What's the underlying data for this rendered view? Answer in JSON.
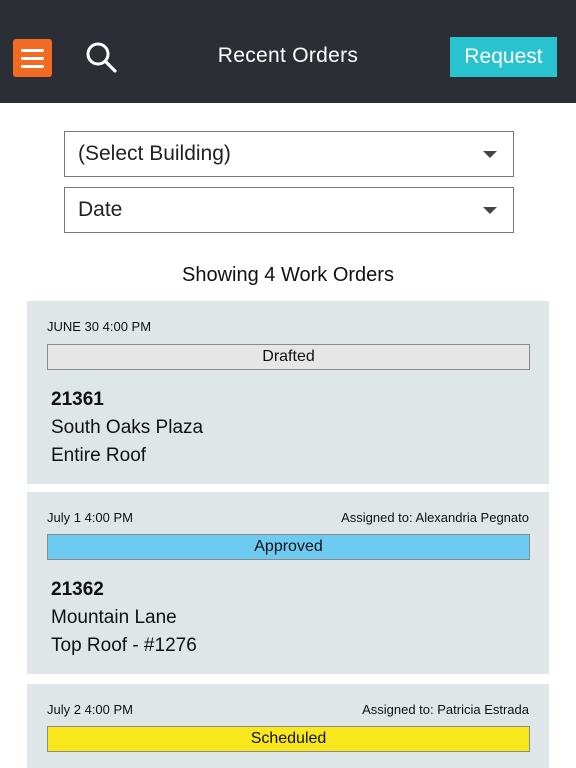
{
  "header": {
    "title": "Recent Orders",
    "request_label": "Request",
    "menu_icon": "hamburger-menu-icon",
    "search_icon": "search-icon",
    "menu_color": "#f26b22",
    "request_color": "#29c3cf"
  },
  "filters": {
    "building": "(Select Building)",
    "date": "Date"
  },
  "summary": "Showing 4 Work Orders",
  "orders": [
    {
      "date": "JUNE 30 4:00 PM",
      "assigned": "",
      "status": "Drafted",
      "status_color": "#e6e6e6",
      "number": "21361",
      "location": "South Oaks Plaza",
      "area": "Entire Roof"
    },
    {
      "date": "July 1 4:00 PM",
      "assigned": "Assigned to: Alexandria Pegnato",
      "status": "Approved",
      "status_color": "#6dcbf2",
      "number": "21362",
      "location": "Mountain Lane",
      "area": "Top Roof - #1276"
    },
    {
      "date": "July 2 4:00 PM",
      "assigned": "Assigned to: Patricia  Estrada",
      "status": "Scheduled",
      "status_color": "#f8e71c"
    }
  ]
}
